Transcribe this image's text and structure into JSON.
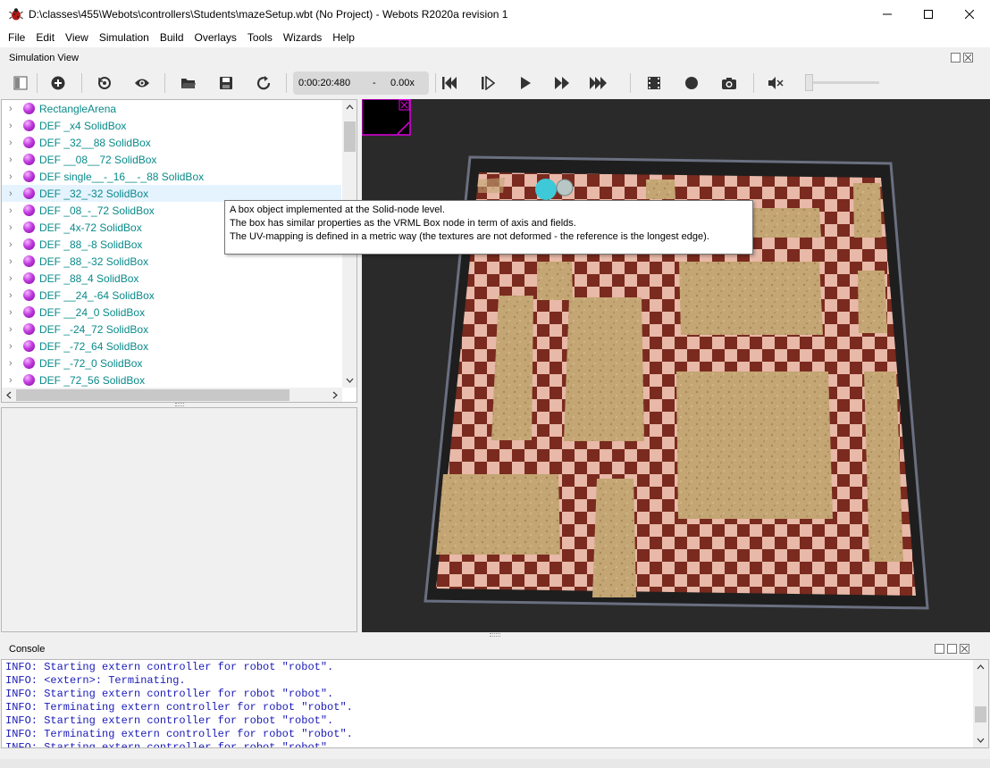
{
  "window": {
    "title": "D:\\classes\\455\\Webots\\controllers\\Students\\mazeSetup.wbt (No Project) - Webots R2020a revision 1"
  },
  "menu": [
    "File",
    "Edit",
    "View",
    "Simulation",
    "Build",
    "Overlays",
    "Tools",
    "Wizards",
    "Help"
  ],
  "simulation_view": {
    "title": "Simulation View"
  },
  "toolbar": {
    "time": "0:00:20:480",
    "separator": "-",
    "speed": "0.00x",
    "icons": [
      "sidebar-toggle-icon",
      "add-node-icon",
      "reset-view-icon",
      "eye-icon",
      "open-folder-icon",
      "save-icon",
      "reload-icon",
      "step-back-icon",
      "step-icon",
      "play-icon",
      "fast-forward-icon",
      "fastest-icon",
      "record-movie-icon",
      "record-icon",
      "screenshot-icon",
      "mute-icon"
    ]
  },
  "scene_tree": {
    "items": [
      "RectangleArena",
      "DEF _x4 SolidBox",
      "DEF _32__88 SolidBox",
      "DEF __08__72 SolidBox",
      "DEF single__-_16__-_88 SolidBox",
      "DEF _32_-32 SolidBox",
      "DEF _08_-_72 SolidBox",
      "DEF _4x-72 SolidBox",
      "DEF _88_-8 SolidBox",
      "DEF _88_-32 SolidBox",
      "DEF _88_4 SolidBox",
      "DEF __24_-64 SolidBox",
      "DEF __24_0 SolidBox",
      "DEF _-24_72 SolidBox",
      "DEF _-72_64 SolidBox",
      "DEF _-72_0 SolidBox",
      "DEF _72_56 SolidBox"
    ],
    "highlighted_index": 5
  },
  "tooltip": {
    "line1": "A box object implemented at the Solid-node level.",
    "line2": "The box has similar properties as the VRML Box node in term of axis and fields.",
    "line3": "The UV-mapping is defined in a metric way (the textures are not deformed - the reference is the longest edge)."
  },
  "console": {
    "title": "Console",
    "lines": [
      "INFO: Starting extern controller for robot \"robot\".",
      "INFO: <extern>: Terminating.",
      "INFO: Starting extern controller for robot \"robot\".",
      "INFO: Terminating extern controller for robot \"robot\".",
      "INFO: Starting extern controller for robot \"robot\".",
      "INFO: Terminating extern controller for robot \"robot\".",
      "INFO: Starting extern controller for robot \"robot\"."
    ]
  },
  "colors": {
    "node_label": "#0a8a8a",
    "console_text": "#1a1ab8",
    "node_ball": "#c23ce0",
    "robot": "#3ec9d8"
  }
}
